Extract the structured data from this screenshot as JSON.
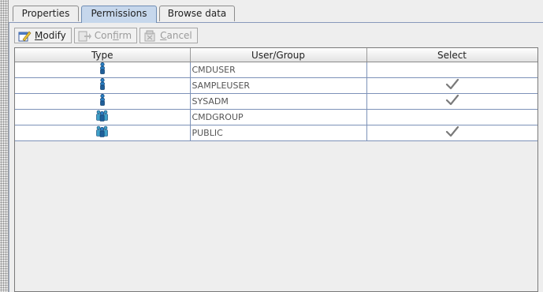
{
  "tabs": [
    {
      "label": "Properties",
      "active": false
    },
    {
      "label": "Permissions",
      "active": true
    },
    {
      "label": "Browse data",
      "active": false
    }
  ],
  "toolbar": {
    "modify_label": "Modify",
    "confirm_label": "Confirm",
    "cancel_label": "Cancel"
  },
  "table": {
    "headers": [
      "Type",
      "User/Group",
      "Select"
    ],
    "rows": [
      {
        "type_icon": "user-icon",
        "name": "CMDUSER",
        "select": false
      },
      {
        "type_icon": "user-icon",
        "name": "SAMPLEUSER",
        "select": true
      },
      {
        "type_icon": "user-icon",
        "name": "SYSADM",
        "select": true
      },
      {
        "type_icon": "group-icon",
        "name": "CMDGROUP",
        "select": false
      },
      {
        "type_icon": "group-icon",
        "name": "PUBLIC",
        "select": true
      }
    ]
  },
  "colors": {
    "active_tab": "#c6d7ec",
    "grid_line": "#7d92b8",
    "user_icon": "#1f6fb5"
  }
}
